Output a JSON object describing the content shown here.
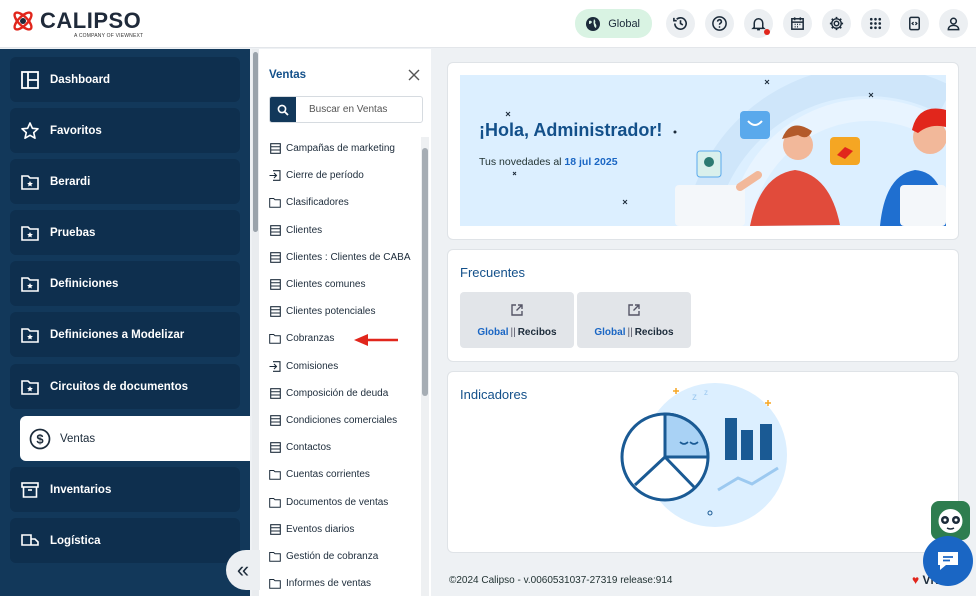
{
  "header": {
    "logo_text": "CALIPSO",
    "logo_sub": "A COMPANY OF VIEWNEXT",
    "global_label": "Global",
    "icons": [
      "history-icon",
      "help-icon",
      "bell-icon",
      "calendar-icon",
      "gear-icon",
      "apps-grid-icon",
      "code-window-icon",
      "user-icon"
    ],
    "notification_color": "#e1261c"
  },
  "sidebar": {
    "items": [
      {
        "label": "Dashboard",
        "icon": "dashboard-icon"
      },
      {
        "label": "Favoritos",
        "icon": "star-icon"
      },
      {
        "label": "Berardi",
        "icon": "folder-star-icon"
      },
      {
        "label": "Pruebas",
        "icon": "folder-star-icon"
      },
      {
        "label": "Definiciones",
        "icon": "folder-star-icon"
      },
      {
        "label": "Definiciones a Modelizar",
        "icon": "folder-star-icon"
      },
      {
        "label": "Circuitos de documentos",
        "icon": "folder-star-icon"
      },
      {
        "label": "Ventas",
        "icon": "dollar-icon",
        "active": true
      },
      {
        "label": "Inventarios",
        "icon": "inventory-icon"
      },
      {
        "label": "Logística",
        "icon": "logistics-icon"
      }
    ]
  },
  "submenu": {
    "title": "Ventas",
    "search_placeholder": "Buscar en Ventas",
    "items": [
      {
        "label": "Campañas de marketing",
        "icon": "list-icon"
      },
      {
        "label": "Cierre de período",
        "icon": "import-icon"
      },
      {
        "label": "Clasificadores",
        "icon": "folder-icon"
      },
      {
        "label": "Clientes",
        "icon": "list-icon"
      },
      {
        "label": "Clientes : Clientes de CABA",
        "icon": "list-icon"
      },
      {
        "label": "Clientes comunes",
        "icon": "list-icon"
      },
      {
        "label": "Clientes potenciales",
        "icon": "list-icon"
      },
      {
        "label": "Cobranzas",
        "icon": "folder-icon"
      },
      {
        "label": "Comisiones",
        "icon": "import-icon"
      },
      {
        "label": "Composición de deuda",
        "icon": "list-icon"
      },
      {
        "label": "Condiciones comerciales",
        "icon": "list-icon"
      },
      {
        "label": "Contactos",
        "icon": "list-icon"
      },
      {
        "label": "Cuentas corrientes",
        "icon": "folder-icon"
      },
      {
        "label": "Documentos de ventas",
        "icon": "folder-icon"
      },
      {
        "label": "Eventos diarios",
        "icon": "list-icon"
      },
      {
        "label": "Gestión de cobranza",
        "icon": "folder-icon"
      },
      {
        "label": "Informes de ventas",
        "icon": "folder-icon"
      }
    ]
  },
  "main": {
    "banner": {
      "greeting": "¡Hola, Administrador!",
      "news_prefix": "Tus novedades al ",
      "news_date": "18 jul 2025"
    },
    "frecuentes": {
      "title": "Frecuentes",
      "buttons": [
        {
          "scope": "Global",
          "sep": "||",
          "label": "Recibos"
        },
        {
          "scope": "Global",
          "sep": "||",
          "label": "Recibos"
        }
      ]
    },
    "indicadores": {
      "title": "Indicadores"
    }
  },
  "footer": {
    "text": "©2024 Calipso - v.0060531037-27319 release:914",
    "brand": "VN"
  },
  "colors": {
    "sidebar": "#12385a",
    "accent": "#13508a",
    "link": "#1a66c4",
    "arrow": "#e1261c"
  }
}
